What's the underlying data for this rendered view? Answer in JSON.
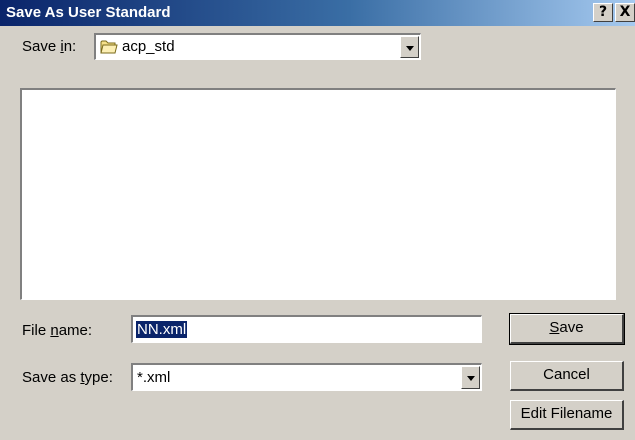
{
  "window": {
    "title": "Save As User Standard",
    "help_glyph": "?",
    "close_glyph": "X"
  },
  "save_in": {
    "label_pre": "Save ",
    "label_accel": "i",
    "label_post": "n:",
    "value": "acp_std",
    "icon": "folder-icon"
  },
  "file_name": {
    "label_pre": "File ",
    "label_accel": "n",
    "label_post": "ame:",
    "value": "NN.xml"
  },
  "save_as_type": {
    "label_pre": "Save as ",
    "label_accel": "t",
    "label_post": "ype:",
    "value": "*.xml"
  },
  "buttons": {
    "save_accel": "S",
    "save_rest": "ave",
    "cancel": "Cancel",
    "edit_filename": "Edit Filename"
  },
  "colors": {
    "titlebar_start": "#0a246a",
    "titlebar_end": "#a6caf0",
    "face": "#d4d0c8"
  }
}
